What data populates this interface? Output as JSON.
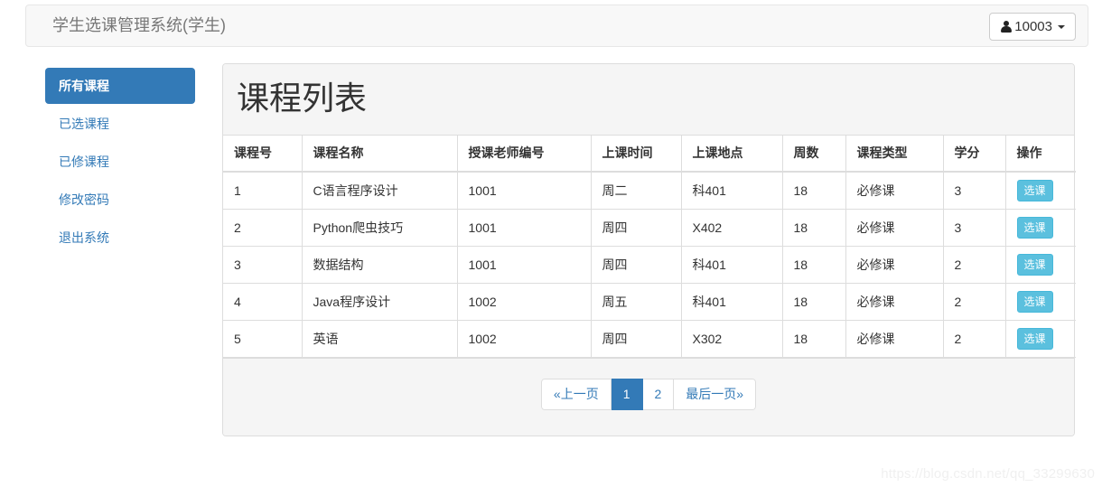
{
  "navbar": {
    "brand": "学生选课管理系统(学生)",
    "user": {
      "icon": "user-icon",
      "label": "10003",
      "caret": "chevron-down-icon"
    }
  },
  "sidebar": {
    "items": [
      {
        "label": "所有课程",
        "active": true
      },
      {
        "label": "已选课程",
        "active": false
      },
      {
        "label": "已修课程",
        "active": false
      },
      {
        "label": "修改密码",
        "active": false
      },
      {
        "label": "退出系统",
        "active": false
      }
    ]
  },
  "panel": {
    "title": "课程列表",
    "table": {
      "columns": [
        "课程号",
        "课程名称",
        "授课老师编号",
        "上课时间",
        "上课地点",
        "周数",
        "课程类型",
        "学分",
        "操作"
      ],
      "rows": [
        {
          "id": "1",
          "name": "C语言程序设计",
          "teacher_id": "1001",
          "time": "周二",
          "place": "科401",
          "weeks": "18",
          "type": "必修课",
          "credit": "3",
          "action": "选课"
        },
        {
          "id": "2",
          "name": "Python爬虫技巧",
          "teacher_id": "1001",
          "time": "周四",
          "place": "X402",
          "weeks": "18",
          "type": "必修课",
          "credit": "3",
          "action": "选课"
        },
        {
          "id": "3",
          "name": "数据结构",
          "teacher_id": "1001",
          "time": "周四",
          "place": "科401",
          "weeks": "18",
          "type": "必修课",
          "credit": "2",
          "action": "选课"
        },
        {
          "id": "4",
          "name": "Java程序设计",
          "teacher_id": "1002",
          "time": "周五",
          "place": "科401",
          "weeks": "18",
          "type": "必修课",
          "credit": "2",
          "action": "选课"
        },
        {
          "id": "5",
          "name": "英语",
          "teacher_id": "1002",
          "time": "周四",
          "place": "X302",
          "weeks": "18",
          "type": "必修课",
          "credit": "2",
          "action": "选课"
        }
      ]
    },
    "pagination": [
      {
        "label": "«上一页",
        "active": false
      },
      {
        "label": "1",
        "active": true
      },
      {
        "label": "2",
        "active": false
      },
      {
        "label": "最后一页»",
        "active": false
      }
    ]
  },
  "watermark": "https://blog.csdn.net/qq_33299630",
  "colors": {
    "primary": "#337ab7",
    "info": "#5bc0de",
    "panel_bg": "#f5f5f5",
    "navbar_bg": "#f8f8f8",
    "border": "#dddddd"
  }
}
